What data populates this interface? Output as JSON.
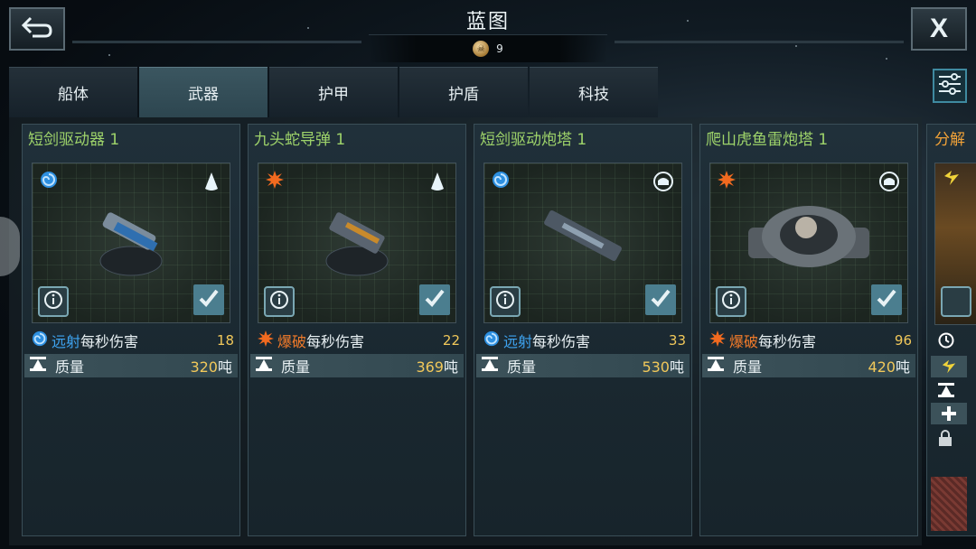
{
  "header": {
    "title": "蓝图",
    "currency_amount": "9",
    "back_icon": "back-arrow-icon",
    "close_label": "X"
  },
  "tabs": [
    {
      "label": "船体",
      "active": false
    },
    {
      "label": "武器",
      "active": true
    },
    {
      "label": "护甲",
      "active": false
    },
    {
      "label": "护盾",
      "active": false
    },
    {
      "label": "科技",
      "active": false
    }
  ],
  "cards": [
    {
      "name": "短剑驱动器 1",
      "damage_type": "远射",
      "damage_label": "每秒伤害",
      "damage_value": "18",
      "mass_label": "质量",
      "mass_value": "320",
      "mass_unit": "吨",
      "type_icon": "spiral-icon",
      "class_icon": "crystal-icon",
      "accent": "#3ea3f0"
    },
    {
      "name": "九头蛇导弹 1",
      "damage_type": "爆破",
      "damage_label": "每秒伤害",
      "damage_value": "22",
      "mass_label": "质量",
      "mass_value": "369",
      "mass_unit": "吨",
      "type_icon": "burst-icon",
      "class_icon": "crystal-icon",
      "accent": "#f07a2a"
    },
    {
      "name": "短剑驱动炮塔 1",
      "damage_type": "远射",
      "damage_label": "每秒伤害",
      "damage_value": "33",
      "mass_label": "质量",
      "mass_value": "530",
      "mass_unit": "吨",
      "type_icon": "spiral-icon",
      "class_icon": "dome-icon",
      "accent": "#3ea3f0"
    },
    {
      "name": "爬山虎鱼雷炮塔 1",
      "damage_type": "爆破",
      "damage_label": "每秒伤害",
      "damage_value": "96",
      "mass_label": "质量",
      "mass_value": "420",
      "mass_unit": "吨",
      "type_icon": "burst-icon",
      "class_icon": "dome-icon",
      "accent": "#f07a2a"
    }
  ],
  "partial_card": {
    "name": "分解"
  }
}
